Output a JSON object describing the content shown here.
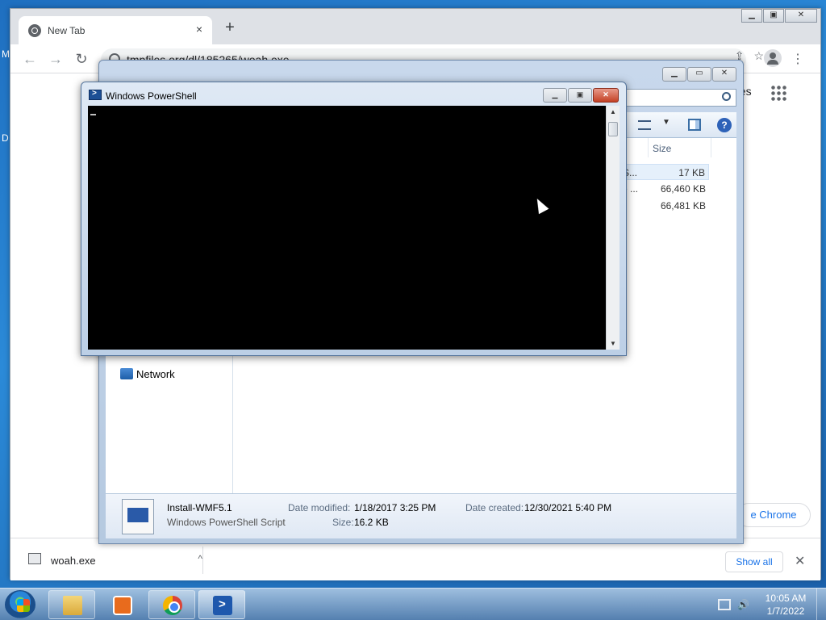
{
  "desktop": {
    "frag_top": "M",
    "frag_mid": "D"
  },
  "chrome": {
    "tab_title": "New Tab",
    "tab_close": "×",
    "new_tab": "+",
    "url": "tmpfiles.org/dl/185265/woah.exe",
    "images_link": "ges",
    "customize_btn": "e Chrome",
    "download": {
      "file": "woah.exe",
      "caret": "^"
    },
    "show_all": "Show all",
    "shelf_close": "✕"
  },
  "explorer": {
    "size_header": "Size",
    "files": [
      {
        "name_frag": "S...",
        "size": "17 KB"
      },
      {
        "name_frag": "e ...",
        "size": "66,460 KB"
      },
      {
        "name_frag": "",
        "size": "66,481 KB"
      }
    ],
    "network": "Network",
    "details": {
      "name": "Install-WMF5.1",
      "type": "Windows PowerShell Script",
      "date_modified_label": "Date modified:",
      "date_modified": "1/18/2017 3:25 PM",
      "size_label": "Size:",
      "size": "16.2 KB",
      "date_created_label": "Date created:",
      "date_created": "12/30/2021 5:40 PM"
    }
  },
  "powershell": {
    "title": "Windows PowerShell"
  },
  "taskbar": {
    "time": "10:05 AM",
    "date": "1/7/2022"
  },
  "colors": {
    "accent": "#1a73e8",
    "console_bg": "#000000",
    "close_red": "#c44125"
  }
}
